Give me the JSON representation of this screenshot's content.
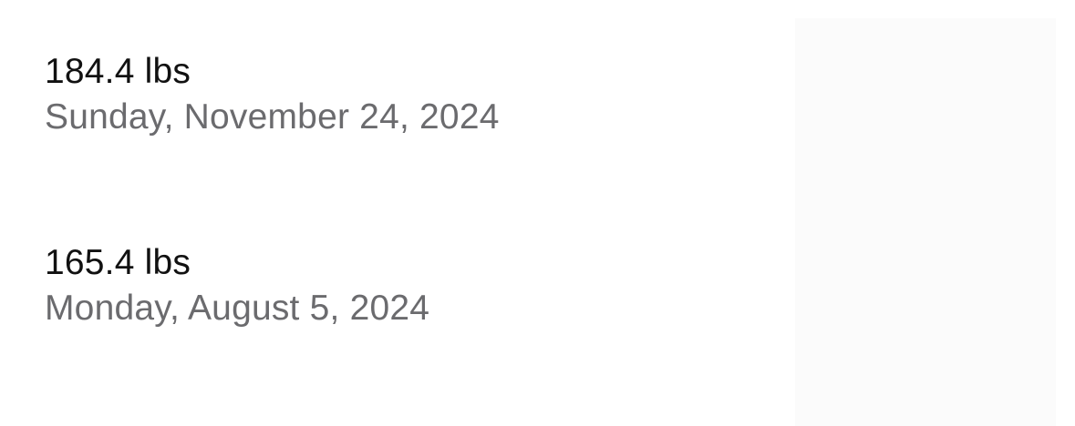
{
  "entries": [
    {
      "weight": "184.4 lbs",
      "date": "Sunday, November 24, 2024"
    },
    {
      "weight": "165.4 lbs",
      "date": "Monday, August 5, 2024"
    }
  ],
  "colors": {
    "background": "#ffffff",
    "primary_text": "#111111",
    "secondary_text": "#6b6b6e",
    "side_panel": "#fbfbfb"
  }
}
